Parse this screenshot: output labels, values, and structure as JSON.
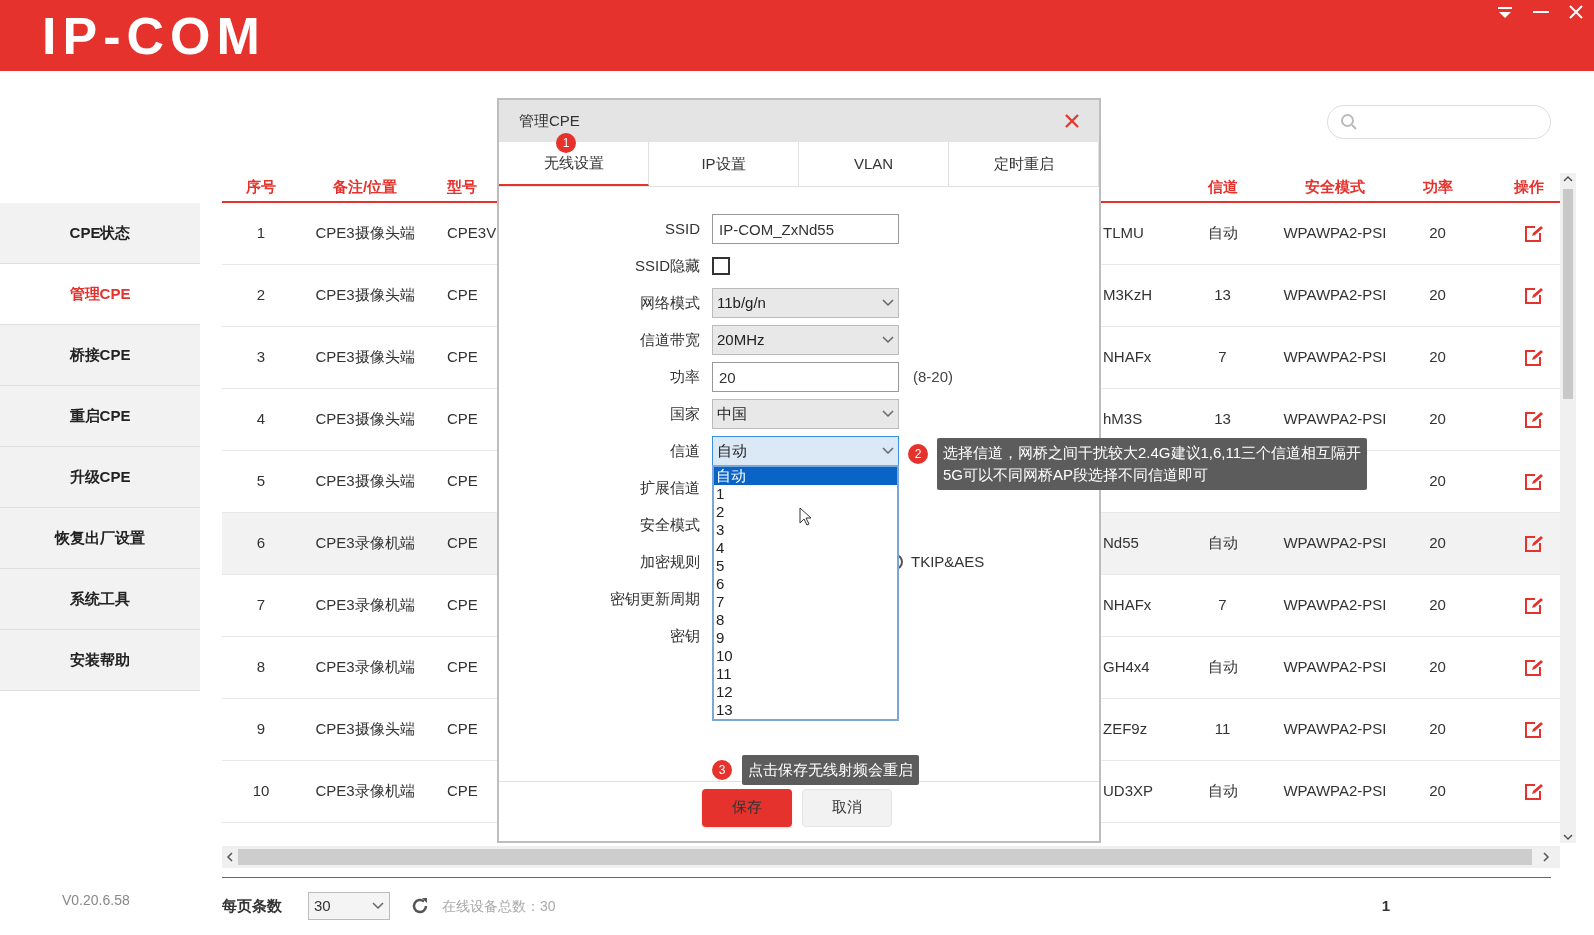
{
  "app": {
    "logo": "IP-COM",
    "version": "V0.20.6.58"
  },
  "sidebar": {
    "items": [
      {
        "label": "CPE状态",
        "selected": false
      },
      {
        "label": "管理CPE",
        "selected": true
      },
      {
        "label": "桥接CPE",
        "selected": false
      },
      {
        "label": "重启CPE",
        "selected": false
      },
      {
        "label": "升级CPE",
        "selected": false
      },
      {
        "label": "恢复出厂设置",
        "selected": false
      },
      {
        "label": "系统工具",
        "selected": false
      },
      {
        "label": "安装帮助",
        "selected": false
      }
    ]
  },
  "table": {
    "columns": [
      "序号",
      "备注/位置",
      "型号",
      "",
      "信道",
      "安全模式",
      "功率",
      "操作"
    ],
    "rows": [
      {
        "selected": false,
        "cells": [
          "1",
          "CPE3摄像头端",
          "CPE3V",
          "TLMU",
          "自动",
          "WPAWPA2-PSI",
          "20"
        ]
      },
      {
        "selected": false,
        "cells": [
          "2",
          "CPE3摄像头端",
          "CPE",
          "M3KzH",
          "13",
          "WPAWPA2-PSI",
          "20"
        ]
      },
      {
        "selected": false,
        "cells": [
          "3",
          "CPE3摄像头端",
          "CPE",
          "NHAFx",
          "7",
          "WPAWPA2-PSI",
          "20"
        ]
      },
      {
        "selected": false,
        "cells": [
          "4",
          "CPE3摄像头端",
          "CPE",
          "hM3S",
          "13",
          "WPAWPA2-PSI",
          "20"
        ]
      },
      {
        "selected": false,
        "cells": [
          "5",
          "CPE3摄像头端",
          "CPE",
          "",
          "",
          "",
          "20"
        ]
      },
      {
        "selected": true,
        "cells": [
          "6",
          "CPE3录像机端",
          "CPE",
          "Nd55",
          "自动",
          "WPAWPA2-PSI",
          "20"
        ]
      },
      {
        "selected": false,
        "cells": [
          "7",
          "CPE3录像机端",
          "CPE",
          "NHAFx",
          "7",
          "WPAWPA2-PSI",
          "20"
        ]
      },
      {
        "selected": false,
        "cells": [
          "8",
          "CPE3录像机端",
          "CPE",
          "GH4x4",
          "自动",
          "WPAWPA2-PSI",
          "20"
        ]
      },
      {
        "selected": false,
        "cells": [
          "9",
          "CPE3摄像头端",
          "CPE",
          "ZEF9z",
          "11",
          "WPAWPA2-PSI",
          "20"
        ]
      },
      {
        "selected": false,
        "cells": [
          "10",
          "CPE3录像机端",
          "CPE",
          "UD3XP",
          "自动",
          "WPAWPA2-PSI",
          "20"
        ]
      }
    ]
  },
  "footer": {
    "page_size_label": "每页条数",
    "page_size": "30",
    "online_total": "在线设备总数：30",
    "page": "1"
  },
  "dialog": {
    "title": "管理CPE",
    "tabs": [
      {
        "label": "无线设置",
        "selected": true
      },
      {
        "label": "IP设置",
        "selected": false
      },
      {
        "label": "VLAN",
        "selected": false
      },
      {
        "label": "定时重启",
        "selected": false
      }
    ],
    "form": [
      {
        "kind": "text",
        "label": "SSID",
        "value": "IP-COM_ZxNd55"
      },
      {
        "kind": "checkbox",
        "label": "SSID隐藏",
        "checked": false
      },
      {
        "kind": "select",
        "label": "网络模式",
        "value": "11b/g/n",
        "open": false
      },
      {
        "kind": "select",
        "label": "信道带宽",
        "value": "20MHz",
        "open": false
      },
      {
        "kind": "text",
        "label": "功率",
        "value": "20",
        "hint": "(8-20)"
      },
      {
        "kind": "select",
        "label": "国家",
        "value": "中国",
        "open": false
      },
      {
        "kind": "select",
        "label": "信道",
        "value": "自动",
        "open": true
      },
      {
        "kind": "label",
        "label": "扩展信道"
      },
      {
        "kind": "label",
        "label": "安全模式"
      },
      {
        "kind": "radio",
        "label": "加密规则",
        "option": "TKIP&AES",
        "checked": false
      },
      {
        "kind": "label",
        "label": "密钥更新周期"
      },
      {
        "kind": "label",
        "label": "密钥"
      }
    ],
    "channel_options": [
      {
        "label": "自动",
        "selected": true
      },
      {
        "label": "1",
        "selected": false
      },
      {
        "label": "2",
        "selected": false
      },
      {
        "label": "3",
        "selected": false
      },
      {
        "label": "4",
        "selected": false
      },
      {
        "label": "5",
        "selected": false
      },
      {
        "label": "6",
        "selected": false
      },
      {
        "label": "7",
        "selected": false
      },
      {
        "label": "8",
        "selected": false
      },
      {
        "label": "9",
        "selected": false
      },
      {
        "label": "10",
        "selected": false
      },
      {
        "label": "11",
        "selected": false
      },
      {
        "label": "12",
        "selected": false
      },
      {
        "label": "13",
        "selected": false
      }
    ],
    "buttons": [
      {
        "kind": "primary",
        "label": "保存"
      },
      {
        "kind": "secondary",
        "label": "取消"
      }
    ]
  },
  "annotations": [
    {
      "number": "1"
    },
    {
      "number": "2",
      "text": "选择信道，网桥之间干扰较大2.4G建议1,6,11三个信道相互隔开\n5G可以不同网桥AP段选择不同信道即可"
    },
    {
      "number": "3",
      "text": "点击保存无线射频会重启"
    }
  ]
}
